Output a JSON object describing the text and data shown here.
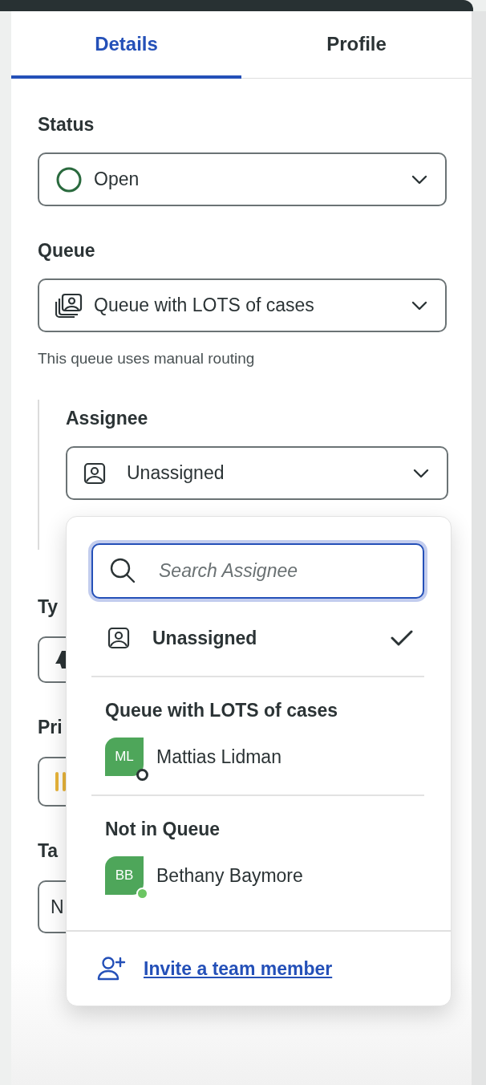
{
  "tabs": [
    {
      "label": "Details",
      "selected": true
    },
    {
      "label": "Profile",
      "selected": false
    }
  ],
  "fields": [
    {
      "label": "Status",
      "kind": "status",
      "value": "Open"
    },
    {
      "label": "Queue",
      "kind": "queue",
      "value": "Queue with LOTS of cases",
      "hint": "This queue uses manual routing"
    }
  ],
  "assignee": {
    "label": "Assignee",
    "value": "Unassigned"
  },
  "covered_fields": [
    {
      "label": "Ty",
      "kind": "type"
    },
    {
      "label": "Pri",
      "kind": "priority"
    },
    {
      "label": "Ta",
      "kind": "tags",
      "value": "N"
    }
  ],
  "assignee_menu": {
    "search": {
      "placeholder": "Search Assignee"
    },
    "unassigned": {
      "label": "Unassigned",
      "selected": true
    },
    "groups": [
      {
        "title": "Queue with LOTS of cases",
        "members": [
          {
            "initials": "ML",
            "name": "Mattias Lidman",
            "online": false
          }
        ]
      },
      {
        "title": "Not in Queue",
        "members": [
          {
            "initials": "BB",
            "name": "Bethany Baymore",
            "online": true
          }
        ]
      }
    ],
    "footer_link": "Invite a team member"
  }
}
